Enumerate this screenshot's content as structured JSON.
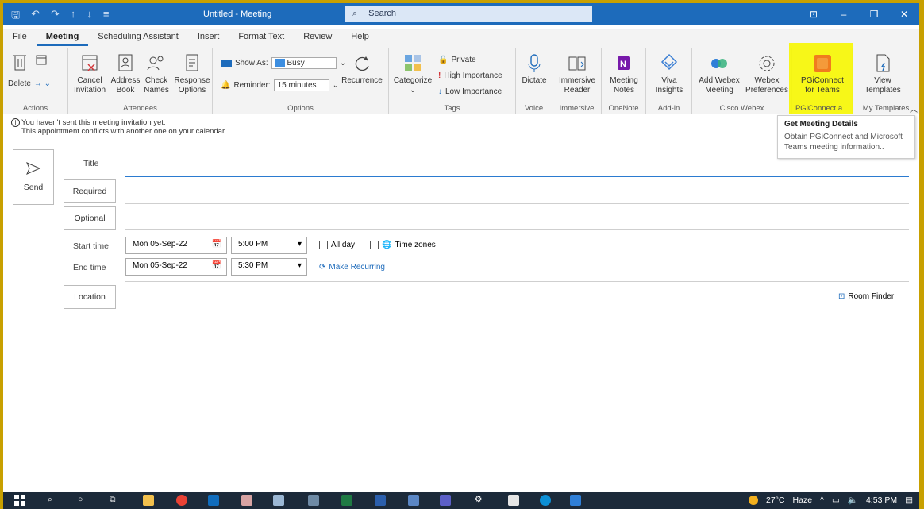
{
  "titlebar": {
    "title": "Untitled - Meeting",
    "search_label": "Search",
    "search_icon": "magnifier-icon"
  },
  "tabs": [
    "File",
    "Meeting",
    "Scheduling Assistant",
    "Insert",
    "Format Text",
    "Review",
    "Help"
  ],
  "ribbon": {
    "actions": {
      "delete": "Delete",
      "group": "Actions"
    },
    "attendees": {
      "cancel": "Cancel",
      "cancel2": "Invitation",
      "address": "Address",
      "address2": "Book",
      "check": "Check",
      "check2": "Names",
      "response": "Response",
      "response2": "Options",
      "group": "Attendees"
    },
    "options": {
      "show_as": "Show As:",
      "busy": "Busy",
      "reminder": "Reminder:",
      "reminder_value": "15 minutes",
      "recurrence": "Recurrence",
      "group": "Options"
    },
    "tags": {
      "categorize": "Categorize",
      "private": "Private",
      "high": "High Importance",
      "low": "Low Importance",
      "group": "Tags"
    },
    "voice": {
      "dictate": "Dictate",
      "group": "Voice"
    },
    "immersive": {
      "reader": "Immersive",
      "reader2": "Reader",
      "group": "Immersive"
    },
    "onenote": {
      "notes": "Meeting",
      "notes2": "Notes",
      "group": "OneNote"
    },
    "addin": {
      "viva": "Viva",
      "viva2": "Insights",
      "group": "Add-in"
    },
    "webex": {
      "add": "Add Webex",
      "add2": "Meeting",
      "prefs": "Webex",
      "prefs2": "Preferences",
      "group": "Cisco Webex"
    },
    "pgi": {
      "label": "PGiConnect",
      "label2": "for Teams",
      "group": "PGiConnect a..."
    },
    "templates": {
      "view": "View",
      "view2": "Templates",
      "group": "My Templates"
    }
  },
  "tooltip": {
    "title": "Get Meeting Details",
    "text": "Obtain PGiConnect and Microsoft Teams meeting information.."
  },
  "info": {
    "line1": "You haven't sent this meeting invitation yet.",
    "line2": "This appointment conflicts with another one on your calendar."
  },
  "form": {
    "send": "Send",
    "title_label": "Title",
    "required": "Required",
    "optional": "Optional",
    "start_label": "Start time",
    "end_label": "End time",
    "start_date": "Mon 05-Sep-22",
    "start_time": "5:00 PM",
    "end_date": "Mon 05-Sep-22",
    "end_time": "5:30 PM",
    "all_day": "All day",
    "time_zones": "Time zones",
    "make_recurring": "Make Recurring",
    "location": "Location",
    "room_finder": "Room Finder"
  },
  "taskbar": {
    "temp": "27°C",
    "weather": "Haze",
    "time": "4:53 PM"
  }
}
